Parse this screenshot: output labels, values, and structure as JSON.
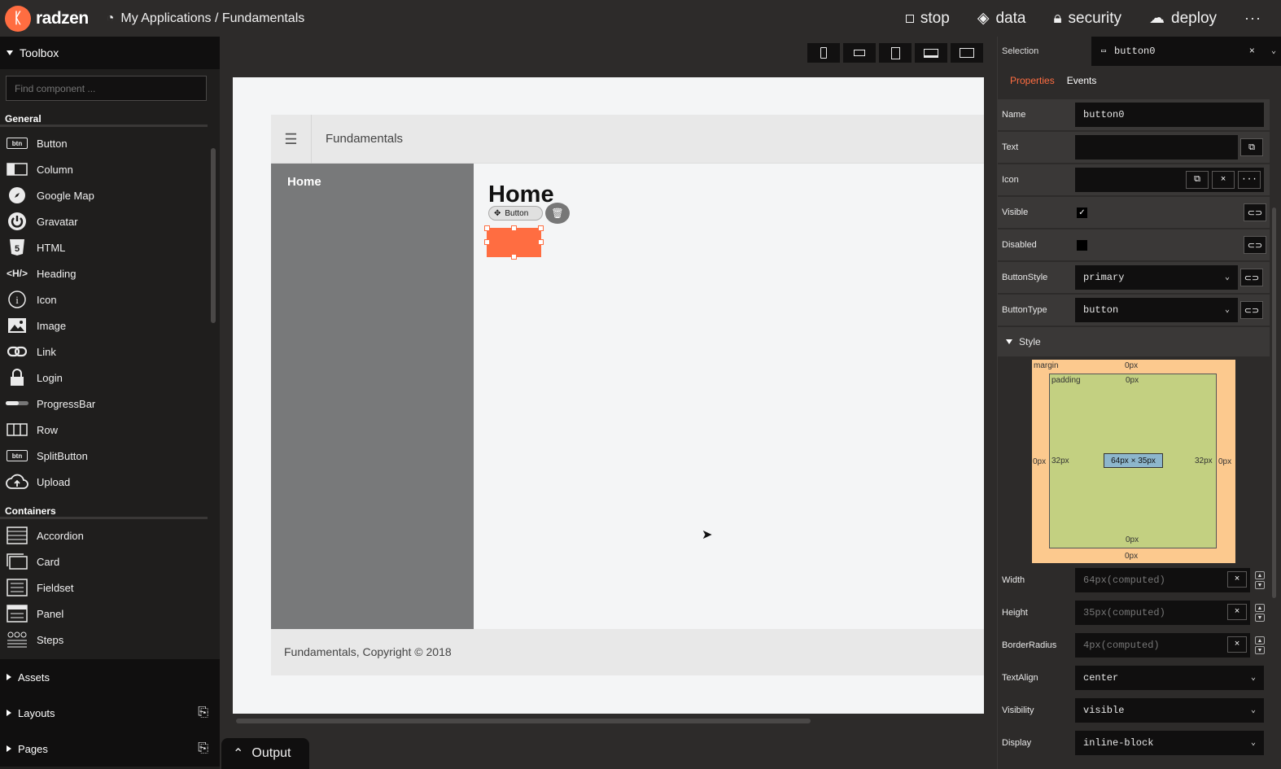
{
  "topbar": {
    "logo_text": "radzen",
    "breadcrumb": "My Applications / Fundamentals",
    "nav": {
      "stop": "stop",
      "data": "data",
      "security": "security",
      "deploy": "deploy",
      "more": "···"
    }
  },
  "toolbox": {
    "title": "Toolbox",
    "search_placeholder": "Find component ...",
    "general_label": "General",
    "general_items": [
      "Button",
      "Column",
      "Google Map",
      "Gravatar",
      "HTML",
      "Heading",
      "Icon",
      "Image",
      "Link",
      "Login",
      "ProgressBar",
      "Row",
      "SplitButton",
      "Upload"
    ],
    "containers_label": "Containers",
    "container_items": [
      "Accordion",
      "Card",
      "Fieldset",
      "Panel",
      "Steps"
    ],
    "sections": {
      "assets": "Assets",
      "layouts": "Layouts",
      "pages": "Pages"
    }
  },
  "canvas": {
    "app_title": "Fundamentals",
    "sidebar_home": "Home",
    "heading": "Home",
    "selected_pill": "Button",
    "footer": "Fundamentals, Copyright © 2018",
    "output_label": "Output"
  },
  "inspector": {
    "selection_label": "Selection",
    "selection_value": "button0",
    "tabs": {
      "properties": "Properties",
      "events": "Events"
    },
    "props": {
      "name_label": "Name",
      "name_value": "button0",
      "text_label": "Text",
      "icon_label": "Icon",
      "visible_label": "Visible",
      "visible_checked": true,
      "disabled_label": "Disabled",
      "buttonstyle_label": "ButtonStyle",
      "buttonstyle_value": "primary",
      "buttontype_label": "ButtonType",
      "buttontype_value": "button"
    },
    "style_label": "Style",
    "box": {
      "margin_label": "margin",
      "padding_label": "padding",
      "margin_top": "0px",
      "margin_bottom": "0px",
      "margin_left": "0px",
      "margin_right": "0px",
      "padding_top": "0px",
      "padding_bottom": "0px",
      "padding_left": "32px",
      "padding_right": "32px",
      "content": "64px × 35px"
    },
    "style_props": {
      "width_label": "Width",
      "width_value": "64px(computed)",
      "height_label": "Height",
      "height_value": "35px(computed)",
      "radius_label": "BorderRadius",
      "radius_value": "4px(computed)",
      "textalign_label": "TextAlign",
      "textalign_value": "center",
      "visibility_label": "Visibility",
      "visibility_value": "visible",
      "display_label": "Display",
      "display_value": "inline-block"
    }
  },
  "colors": {
    "accent": "#ff6d41",
    "panel": "#2d2b2a",
    "dark": "#100f0f"
  }
}
